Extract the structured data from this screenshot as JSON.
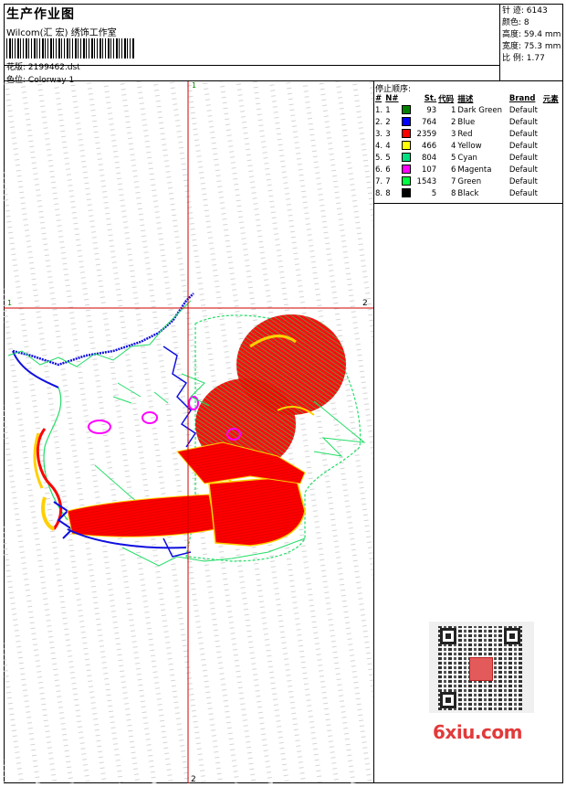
{
  "header": {
    "title": "生产作业图",
    "subtitle": "Wilcom(汇 宏) 绣饰工作室",
    "file_label": "花版:",
    "file_name": "2199462.dst",
    "colorway_label": "色位:",
    "colorway": "Colorway 1"
  },
  "stats": {
    "stitches_label": "针 迹:",
    "stitches": "6143",
    "colors_label": "颜色:",
    "colors": "8",
    "height_label": "高度:",
    "height": "59.4 mm",
    "width_label": "宽度:",
    "width": "75.3 mm",
    "ratio_label": "比 例:",
    "ratio": "1.77"
  },
  "axes": {
    "top": "1",
    "left": "1",
    "right": "2",
    "bottom": "2"
  },
  "stop_sequence": {
    "title": "停止顺序:",
    "headers": [
      "#",
      "N#",
      "St.",
      "代码",
      "描述",
      "Brand",
      "元素"
    ],
    "rows": [
      {
        "idx": "1.",
        "n": "1",
        "color": "#008000",
        "st": "93",
        "code": "1",
        "desc": "Dark Green",
        "brand": "Default"
      },
      {
        "idx": "2.",
        "n": "2",
        "color": "#0000ff",
        "st": "764",
        "code": "2",
        "desc": "Blue",
        "brand": "Default"
      },
      {
        "idx": "3.",
        "n": "3",
        "color": "#ff0000",
        "st": "2359",
        "code": "3",
        "desc": "Red",
        "brand": "Default"
      },
      {
        "idx": "4.",
        "n": "4",
        "color": "#ffff00",
        "st": "466",
        "code": "4",
        "desc": "Yellow",
        "brand": "Default"
      },
      {
        "idx": "5.",
        "n": "5",
        "color": "#00e080",
        "st": "804",
        "code": "5",
        "desc": "Cyan",
        "brand": "Default"
      },
      {
        "idx": "6.",
        "n": "6",
        "color": "#ff00ff",
        "st": "107",
        "code": "6",
        "desc": "Magenta",
        "brand": "Default"
      },
      {
        "idx": "7.",
        "n": "7",
        "color": "#00ff40",
        "st": "1543",
        "code": "7",
        "desc": "Green",
        "brand": "Default"
      },
      {
        "idx": "8.",
        "n": "8",
        "color": "#000000",
        "st": "5",
        "code": "8",
        "desc": "Black",
        "brand": "Default"
      }
    ]
  },
  "watermark": "6xiu.com"
}
